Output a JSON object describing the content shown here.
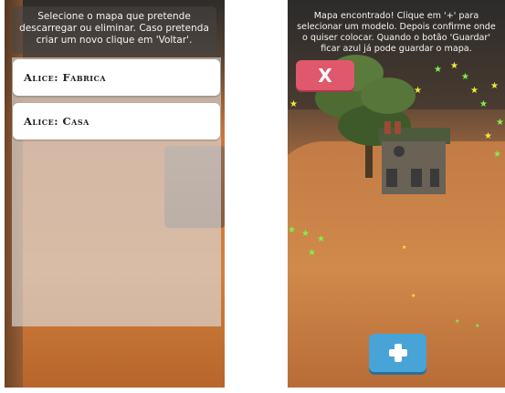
{
  "left_screen": {
    "instruction": "Selecione o mapa que pretende descarregar ou eliminar. Caso pretenda criar um novo clique em 'Voltar'.",
    "maps": [
      {
        "label": "Alice: Fabrica"
      },
      {
        "label": "Alice: Casa"
      }
    ]
  },
  "right_screen": {
    "instruction": "Mapa encontrado! Clique em '+' para selecionar um modelo. Depois confirme onde o quiser colocar. Quando o botão 'Guardar' ficar azul já pode guardar o mapa.",
    "close_label": "X",
    "add_icon": "plus-icon"
  },
  "colors": {
    "close_button": "#e0586b",
    "add_button": "#48a3d7",
    "list_item_bg": "#ffffff"
  }
}
